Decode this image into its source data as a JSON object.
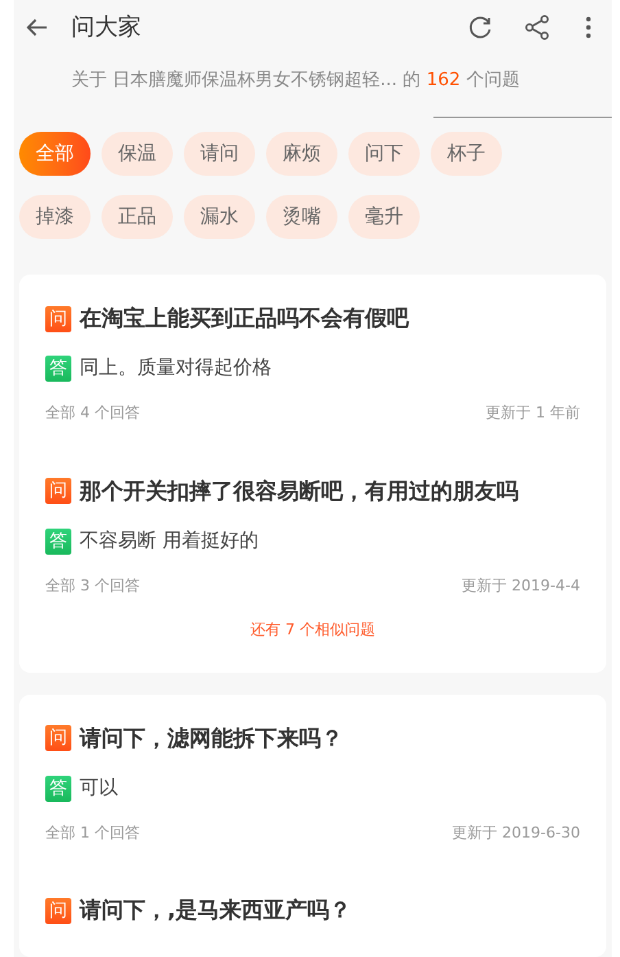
{
  "header": {
    "title": "问大家"
  },
  "summary": {
    "prefix": "关于",
    "product": "日本膳魔师保温杯男女不锈钢超轻...",
    "middle": "的",
    "count": "162",
    "suffix": "个问题"
  },
  "tags": [
    {
      "label": "全部",
      "selected": true
    },
    {
      "label": "保温",
      "selected": false
    },
    {
      "label": "请问",
      "selected": false
    },
    {
      "label": "麻烦",
      "selected": false
    },
    {
      "label": "问下",
      "selected": false
    },
    {
      "label": "杯子",
      "selected": false
    },
    {
      "label": "掉漆",
      "selected": false
    },
    {
      "label": "正品",
      "selected": false
    },
    {
      "label": "漏水",
      "selected": false
    },
    {
      "label": "烫嘴",
      "selected": false
    },
    {
      "label": "毫升",
      "selected": false
    }
  ],
  "cards": [
    {
      "questions": [
        {
          "q_mark": "问",
          "question": "在淘宝上能买到正品吗不会有假吧",
          "a_mark": "答",
          "answer": "同上。质量对得起价格",
          "answer_count": "全部 4 个回答",
          "updated": "更新于 1 年前"
        },
        {
          "q_mark": "问",
          "question": "那个开关扣摔了很容易断吧，有用过的朋友吗",
          "a_mark": "答",
          "answer": "不容易断 用着挺好的",
          "answer_count": "全部 3 个回答",
          "updated": "更新于 2019-4-4"
        }
      ],
      "more": "还有 7 个相似问题"
    },
    {
      "questions": [
        {
          "q_mark": "问",
          "question": "请问下，滤网能拆下来吗？",
          "a_mark": "答",
          "answer": "可以",
          "answer_count": "全部 1 个回答",
          "updated": "更新于 2019-6-30"
        },
        {
          "q_mark": "问",
          "question": "请问下，,是马来西亚产吗？"
        }
      ]
    }
  ]
}
